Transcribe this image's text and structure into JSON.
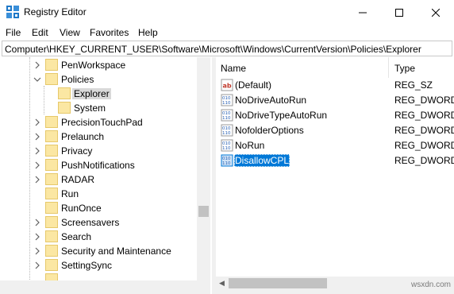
{
  "window": {
    "title": "Registry Editor",
    "icons": {
      "app": "registry-editor-icon",
      "minimize": "minimize-icon",
      "maximize": "maximize-icon",
      "close": "close-icon"
    }
  },
  "menu": {
    "items": [
      {
        "label": "File"
      },
      {
        "label": "Edit"
      },
      {
        "label": "View"
      },
      {
        "label": "Favorites"
      },
      {
        "label": "Help"
      }
    ]
  },
  "address": {
    "path": "Computer\\HKEY_CURRENT_USER\\Software\\Microsoft\\Windows\\CurrentVersion\\Policies\\Explorer"
  },
  "tree": {
    "items": [
      {
        "label": "PenWorkspace",
        "expander": "chevron-right",
        "selected": false
      },
      {
        "label": "Policies",
        "expander": "chevron-down",
        "selected": false
      },
      {
        "label": "Explorer",
        "expander": "none",
        "selected": true
      },
      {
        "label": "System",
        "expander": "none",
        "selected": false
      },
      {
        "label": "PrecisionTouchPad",
        "expander": "chevron-right",
        "selected": false
      },
      {
        "label": "Prelaunch",
        "expander": "chevron-right",
        "selected": false
      },
      {
        "label": "Privacy",
        "expander": "chevron-right",
        "selected": false
      },
      {
        "label": "PushNotifications",
        "expander": "chevron-right",
        "selected": false
      },
      {
        "label": "RADAR",
        "expander": "chevron-right",
        "selected": false
      },
      {
        "label": "Run",
        "expander": "none",
        "selected": false
      },
      {
        "label": "RunOnce",
        "expander": "none",
        "selected": false
      },
      {
        "label": "Screensavers",
        "expander": "chevron-right",
        "selected": false
      },
      {
        "label": "Search",
        "expander": "chevron-right",
        "selected": false
      },
      {
        "label": "Security and Maintenance",
        "expander": "chevron-right",
        "selected": false
      },
      {
        "label": "SettingSync",
        "expander": "chevron-right",
        "selected": false
      }
    ]
  },
  "list": {
    "columns": {
      "name": "Name",
      "type": "Type"
    },
    "rows": [
      {
        "name": "(Default)",
        "type": "REG_SZ",
        "icon": "string-value-icon",
        "selected": false
      },
      {
        "name": "NoDriveAutoRun",
        "type": "REG_DWORD",
        "icon": "binary-value-icon",
        "selected": false
      },
      {
        "name": "NoDriveTypeAutoRun",
        "type": "REG_DWORD",
        "icon": "binary-value-icon",
        "selected": false
      },
      {
        "name": "NofolderOptions",
        "type": "REG_DWORD",
        "icon": "binary-value-icon",
        "selected": false
      },
      {
        "name": "NoRun",
        "type": "REG_DWORD",
        "icon": "binary-value-icon",
        "selected": false
      },
      {
        "name": "DisallowCPL",
        "type": "REG_DWORD",
        "icon": "binary-value-icon",
        "selected": true
      }
    ]
  },
  "watermark": "wsxdn.com",
  "colors": {
    "selection": "#0078d7",
    "tree_selection": "#d9d9d9",
    "folder": "#fbe7a3"
  }
}
